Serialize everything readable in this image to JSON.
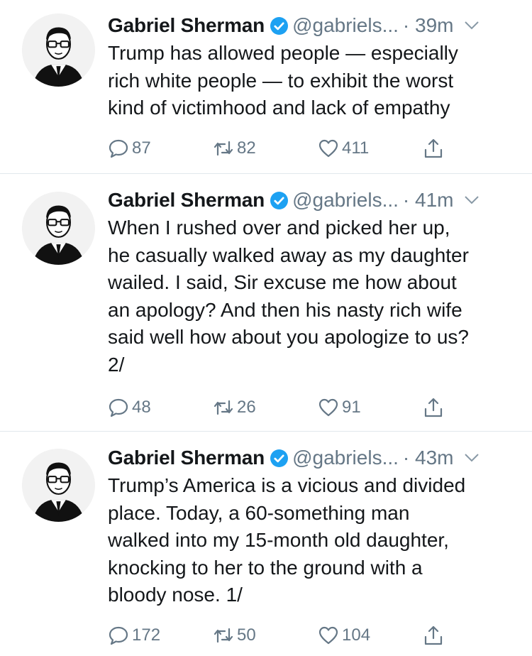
{
  "tweets": [
    {
      "name": "Gabriel Sherman",
      "handle": "@gabriels...",
      "time": "· 39m",
      "text": "Trump has allowed people — especially\nrich white people — to exhibit the worst\nkind of victimhood and lack of empathy",
      "replies": "87",
      "retweets": "82",
      "likes": "411"
    },
    {
      "name": "Gabriel Sherman",
      "handle": "@gabriels...",
      "time": "· 41m",
      "text": "When I rushed over and picked her up,\nhe casually walked away as my daughter\nwailed. I said, Sir excuse me how about\nan apology? And then his nasty rich wife\nsaid well how about you apologize to us?\n2/",
      "replies": "48",
      "retweets": "26",
      "likes": "91"
    },
    {
      "name": "Gabriel Sherman",
      "handle": "@gabriels...",
      "time": "· 43m",
      "text": "Trump’s America is a vicious and divided\nplace. Today, a 60-something man\nwalked into my 15-month old daughter,\nknocking to her to the ground with a\nbloody nose. 1/",
      "replies": "172",
      "retweets": "50",
      "likes": "104"
    }
  ],
  "icons": {
    "verified": "verified-badge-icon",
    "caret": "chevron-down-icon",
    "reply": "reply-icon",
    "retweet": "retweet-icon",
    "like": "heart-icon",
    "share": "share-icon"
  },
  "colors": {
    "verified": "#1da1f2",
    "secondary_text": "#657786",
    "primary_text": "#14171a",
    "divider": "#e1e8ed"
  }
}
